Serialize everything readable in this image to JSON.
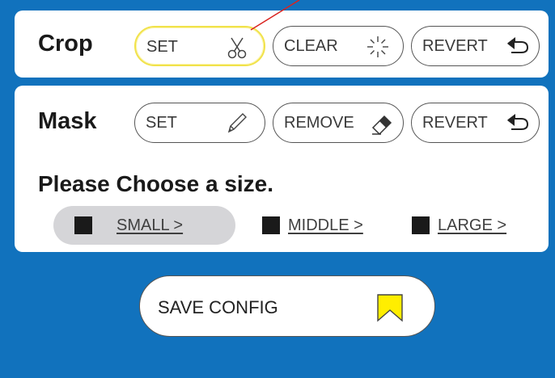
{
  "crop": {
    "title": "Crop",
    "set_label": "SET",
    "set_icon": "scissors-icon",
    "clear_label": "CLEAR",
    "clear_icon": "sparkle-icon",
    "revert_label": "REVERT",
    "revert_icon": "undo-arrow-icon"
  },
  "mask": {
    "title": "Mask",
    "set_label": "SET",
    "set_icon": "pencil-icon",
    "remove_label": "REMOVE",
    "remove_icon": "eraser-icon",
    "revert_label": "REVERT",
    "revert_icon": "undo-arrow-icon"
  },
  "size": {
    "heading": "Please Choose a size.",
    "options": [
      {
        "label": "SMALL >",
        "selected": true
      },
      {
        "label": "MIDDLE >",
        "selected": false
      },
      {
        "label": "LARGE >",
        "selected": false
      }
    ]
  },
  "save": {
    "label": "SAVE CONFIG",
    "icon": "bookmark-icon"
  },
  "colors": {
    "background": "#1172bd",
    "highlight": "#f1e24a",
    "pointer_line": "#d9231f",
    "bookmark": "#ffee00",
    "selected_option": "#d5d5d8"
  }
}
